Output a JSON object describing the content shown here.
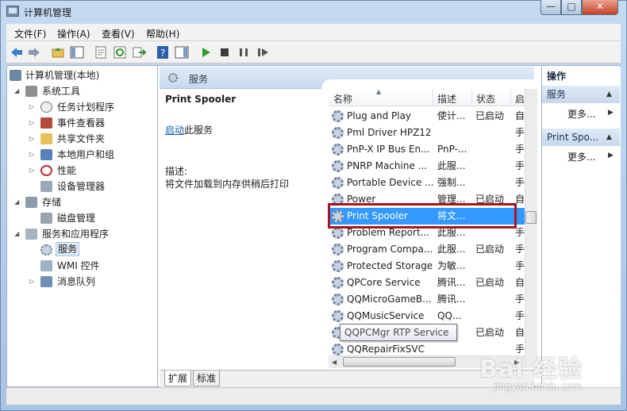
{
  "window": {
    "title": "计算机管理"
  },
  "menu": [
    {
      "label": "文件(F)"
    },
    {
      "label": "操作(A)"
    },
    {
      "label": "查看(V)"
    },
    {
      "label": "帮助(H)"
    }
  ],
  "tree": {
    "root": "计算机管理(本地)",
    "system_tools": "系统工具",
    "task_scheduler": "任务计划程序",
    "event_viewer": "事件查看器",
    "shared_folders": "共享文件夹",
    "local_users": "本地用户和组",
    "performance": "性能",
    "device_manager": "设备管理器",
    "storage": "存储",
    "disk_management": "磁盘管理",
    "services_apps": "服务和应用程序",
    "services": "服务",
    "wmi": "WMI 控件",
    "message_queue": "消息队列"
  },
  "middle": {
    "header": "服务",
    "service_name": "Print Spooler",
    "start_link": "启动",
    "start_rest": "此服务",
    "desc_label": "描述:",
    "desc_text": "将文件加载到内存供稍后打印"
  },
  "list": {
    "columns": [
      "名称",
      "描述",
      "状态",
      "启"
    ],
    "rows": [
      {
        "name": "Plug and Play",
        "desc": "使计...",
        "status": "已启动",
        "start": "自"
      },
      {
        "name": "Pml Driver HPZ12",
        "desc": "",
        "status": "",
        "start": "手"
      },
      {
        "name": "PnP-X IP Bus En...",
        "desc": "PnP-...",
        "status": "",
        "start": "手"
      },
      {
        "name": "PNRP Machine ...",
        "desc": "此服...",
        "status": "",
        "start": "手"
      },
      {
        "name": "Portable Device ...",
        "desc": "强制...",
        "status": "",
        "start": "手"
      },
      {
        "name": "Power",
        "desc": "管理...",
        "status": "已启动",
        "start": "自"
      },
      {
        "name": "Print Spooler",
        "desc": "将文...",
        "status": "",
        "start": ""
      },
      {
        "name": "Problem Report...",
        "desc": "此服...",
        "status": "",
        "start": "手"
      },
      {
        "name": "Program Compa...",
        "desc": "此服...",
        "status": "已启动",
        "start": "手"
      },
      {
        "name": "Protected Storage",
        "desc": "为敏...",
        "status": "",
        "start": "手"
      },
      {
        "name": "QPCore Service",
        "desc": "腾讯...",
        "status": "已启动",
        "start": "自"
      },
      {
        "name": "QQMicroGameB...",
        "desc": "腾讯...",
        "status": "",
        "start": "手"
      },
      {
        "name": "QQMusicService",
        "desc": "QQ...",
        "status": "",
        "start": "手"
      },
      {
        "name": "",
        "desc": "",
        "status": "已启动",
        "start": "自"
      },
      {
        "name": "QQRepairFixSVC",
        "desc": "",
        "status": "",
        "start": "手"
      }
    ],
    "tooltip": "QQPCMgr RTP Service"
  },
  "tabs": [
    "扩展",
    "标准"
  ],
  "actions": {
    "header": "操作",
    "section1": "服务",
    "more1": "更多...",
    "section2": "Print Spo...",
    "more2": "更多..."
  },
  "watermark": {
    "main": "Bai 经验",
    "sub": "jingyan.baidu.com"
  }
}
